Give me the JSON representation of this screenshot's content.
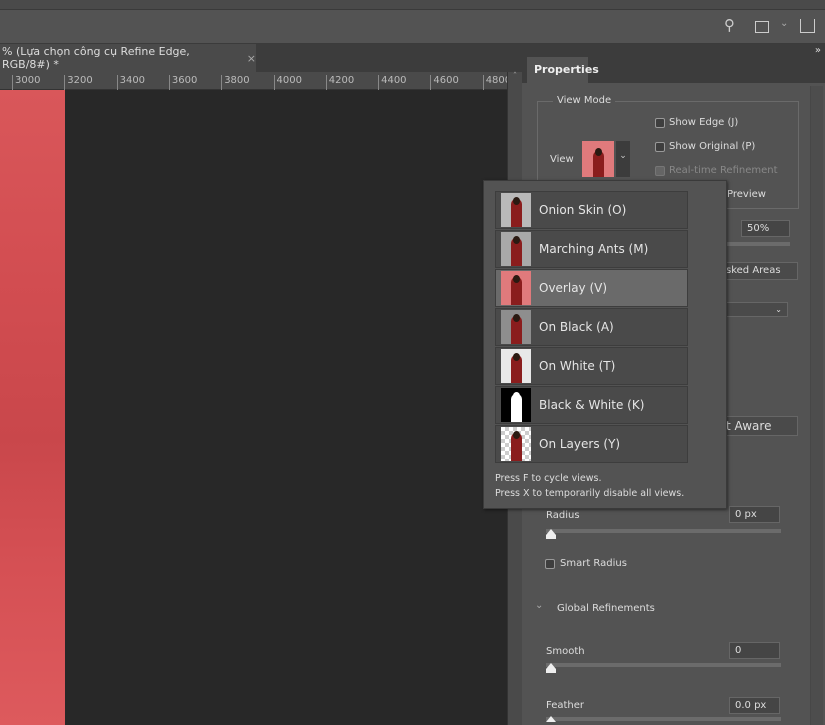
{
  "document": {
    "tab_title": "% (Lựa chọn công cụ Refine Edge, RGB/8#) *",
    "close": "×"
  },
  "ruler": {
    "labels": [
      "3000",
      "3200",
      "3400",
      "3600",
      "3800",
      "4000",
      "4200",
      "4400",
      "4600",
      "4800"
    ]
  },
  "toolbar": {
    "icons": [
      "search-icon",
      "workspace-icon",
      "chevron-down-icon",
      "share-icon"
    ]
  },
  "panel": {
    "collapse": "»",
    "tab": "Properties",
    "view_mode_legend": "View Mode",
    "view_label": "View",
    "show_edge": "Show Edge (J)",
    "show_original": "Show Original (P)",
    "realtime": "Real-time Refinement",
    "preview": "Preview",
    "opacity": "50%",
    "dropdown1": "sked Areas",
    "content_aware": "t Aware",
    "radius_label": "Radius",
    "radius_value": "0 px",
    "smart_radius": "Smart Radius",
    "global_refinements": "Global Refinements",
    "smooth_label": "Smooth",
    "smooth_value": "0",
    "feather_label": "Feather",
    "feather_value": "0.0 px"
  },
  "view_menu": {
    "items": [
      {
        "label": "Onion Skin (O)",
        "thumb": "onion"
      },
      {
        "label": "Marching Ants (M)",
        "thumb": "ants"
      },
      {
        "label": "Overlay (V)",
        "thumb": "overlay",
        "selected": true
      },
      {
        "label": "On Black (A)",
        "thumb": "black"
      },
      {
        "label": "On White (T)",
        "thumb": "white"
      },
      {
        "label": "Black & White (K)",
        "thumb": "bw"
      },
      {
        "label": "On Layers (Y)",
        "thumb": "layers"
      }
    ],
    "hint1": "Press F to cycle views.",
    "hint2": "Press X to temporarily disable all views."
  }
}
